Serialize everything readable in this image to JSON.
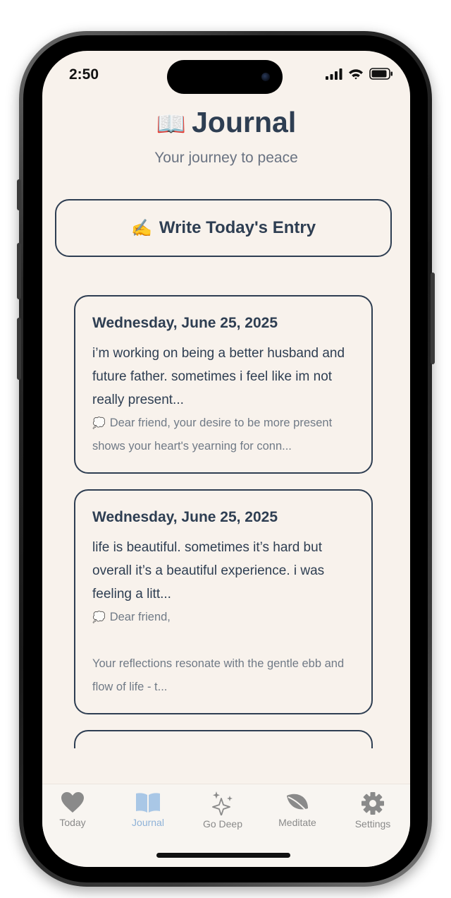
{
  "status": {
    "time": "2:50"
  },
  "header": {
    "emoji": "📖",
    "title": "Journal",
    "subtitle": "Your journey to peace"
  },
  "write_button": {
    "emoji": "✍️",
    "label": "Write Today's Entry"
  },
  "entries": [
    {
      "date": "Wednesday, June 25, 2025",
      "text": "i’m working on being a better husband and future father. sometimes i feel like im not really present...",
      "reply": "Dear friend, your desire to be more present shows your heart's yearning for conn..."
    },
    {
      "date": "Wednesday, June 25, 2025",
      "text": "life is beautiful. sometimes it’s hard but overall it’s a beautiful experience. i was feeling a litt...",
      "reply": "Dear friend,\n\nYour reflections resonate with the gentle ebb and flow of life - t..."
    }
  ],
  "tabs": [
    {
      "label": "Today",
      "icon": "heart-icon",
      "active": false
    },
    {
      "label": "Journal",
      "icon": "book-icon",
      "active": true
    },
    {
      "label": "Go Deep",
      "icon": "sparkles-icon",
      "active": false
    },
    {
      "label": "Meditate",
      "icon": "leaf-icon",
      "active": false
    },
    {
      "label": "Settings",
      "icon": "gear-icon",
      "active": false
    }
  ],
  "colors": {
    "background": "#f8f2ec",
    "primary_text": "#2e3e52",
    "secondary_text": "#707a86",
    "active_tab": "#8fb2d8",
    "inactive_tab": "#8a8a8a"
  }
}
